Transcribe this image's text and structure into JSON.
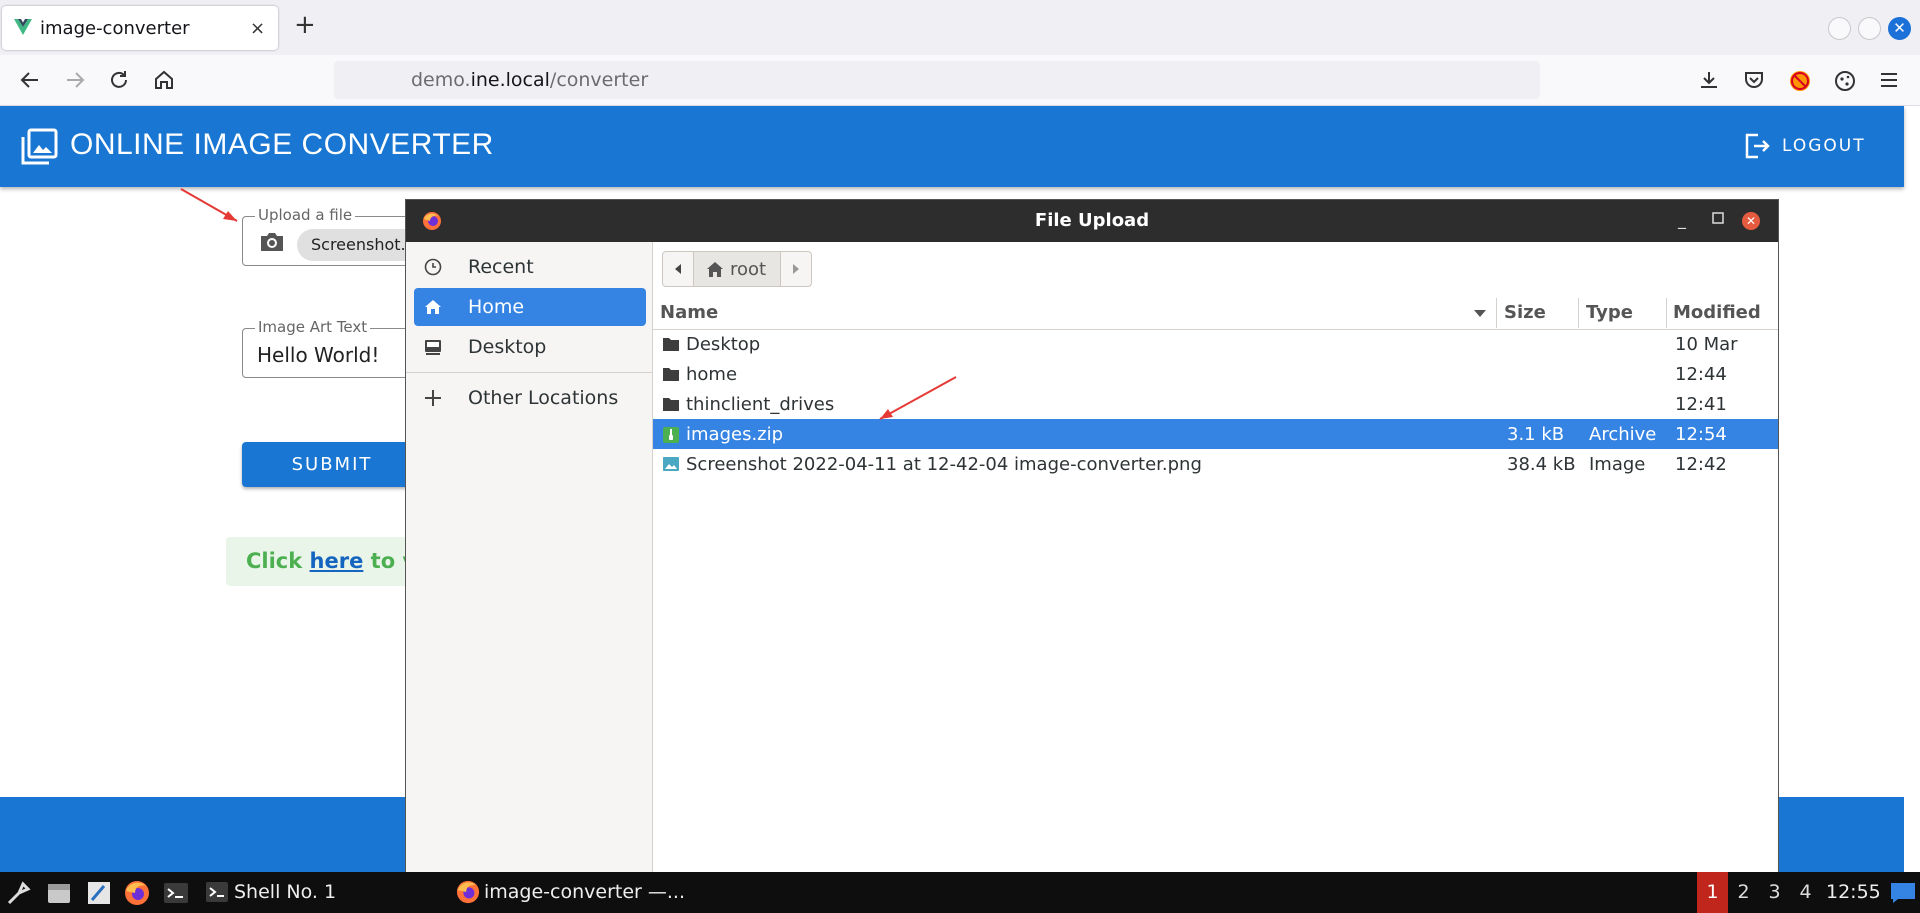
{
  "browser": {
    "tab_title": "image-converter",
    "tab_close": "×",
    "new_tab": "+",
    "url_prefix": "demo.",
    "url_domain": "ine.local",
    "url_path": "/converter"
  },
  "app": {
    "title": "ONLINE IMAGE CONVERTER",
    "logout_label": "LOGOUT",
    "upload_label": "Upload a file",
    "upload_chip": "Screenshot...",
    "art_label": "Image Art Text",
    "art_value": "Hello World!",
    "submit_label": "SUBMIT",
    "alert_prefix": "Click ",
    "alert_link": "here",
    "alert_suffix": " to v"
  },
  "dialog": {
    "title": "File Upload",
    "sidebar": [
      {
        "label": "Recent",
        "icon": "clock-icon"
      },
      {
        "label": "Home",
        "icon": "home-icon"
      },
      {
        "label": "Desktop",
        "icon": "desktop-icon"
      },
      {
        "label": "Other Locations",
        "icon": "plus-icon"
      }
    ],
    "path_segment": "root",
    "columns": {
      "name": "Name",
      "size": "Size",
      "type": "Type",
      "modified": "Modified"
    },
    "files": [
      {
        "name": "Desktop",
        "size": "",
        "type": "",
        "modified": "10 Mar",
        "icon": "folder-icon"
      },
      {
        "name": "home",
        "size": "",
        "type": "",
        "modified": "12:44",
        "icon": "folder-icon"
      },
      {
        "name": "thinclient_drives",
        "size": "",
        "type": "",
        "modified": "12:41",
        "icon": "folder-icon"
      },
      {
        "name": "images.zip",
        "size": "3.1  kB",
        "type": "Archive",
        "modified": "12:54",
        "icon": "archive-icon",
        "selected": true
      },
      {
        "name": "Screenshot 2022-04-11 at 12-42-04 image-converter.png",
        "size": "38.4  kB",
        "type": "Image",
        "modified": "12:42",
        "icon": "image-icon"
      }
    ]
  },
  "taskbar": {
    "shell_label": "Shell No. 1",
    "browser_label": "image-converter —...",
    "workspaces": [
      "1",
      "2",
      "3",
      "4"
    ],
    "active_workspace": "1",
    "clock": "12:55"
  },
  "colors": {
    "brand": "#1976d2",
    "selection": "#3584e4",
    "annotation_arrow": "#e53935"
  }
}
